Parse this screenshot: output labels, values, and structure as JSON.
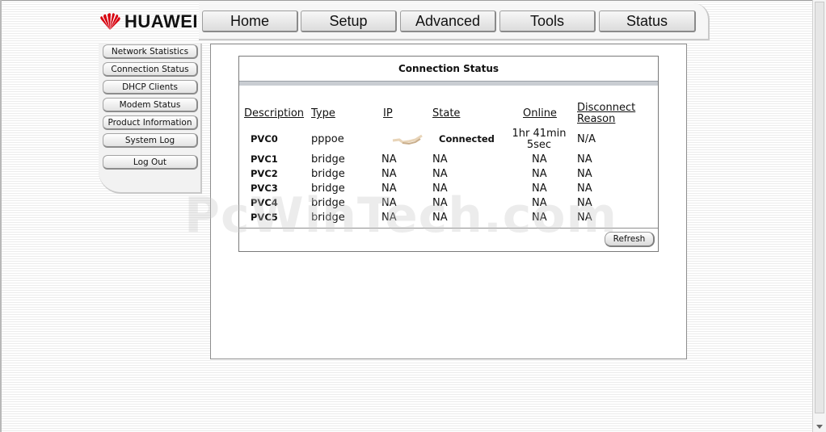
{
  "brand": {
    "name": "HUAWEI",
    "logo_color": "#d7000f"
  },
  "tabs": [
    {
      "label": "Home"
    },
    {
      "label": "Setup"
    },
    {
      "label": "Advanced"
    },
    {
      "label": "Tools"
    },
    {
      "label": "Status"
    }
  ],
  "sidebar": {
    "items": [
      {
        "label": "Network Statistics"
      },
      {
        "label": "Connection Status"
      },
      {
        "label": "DHCP Clients"
      },
      {
        "label": "Modem Status"
      },
      {
        "label": "Product Information"
      },
      {
        "label": "System Log"
      },
      {
        "label": "Log Out"
      }
    ]
  },
  "main": {
    "title": "Connection Status",
    "columns": {
      "description": "Description",
      "type": "Type",
      "ip": "IP",
      "state": "State",
      "online": "Online",
      "disconnect_line1": "Disconnect",
      "disconnect_line2": "Reason"
    },
    "rows": [
      {
        "description": "PVC0",
        "type": "pppoe",
        "ip": "",
        "state": "Connected",
        "online_line1": "1hr 41min",
        "online_line2": "5sec",
        "reason": "N/A"
      },
      {
        "description": "PVC1",
        "type": "bridge",
        "ip": "NA",
        "state": "NA",
        "online_line1": "NA",
        "online_line2": "",
        "reason": "NA"
      },
      {
        "description": "PVC2",
        "type": "bridge",
        "ip": "NA",
        "state": "NA",
        "online_line1": "NA",
        "online_line2": "",
        "reason": "NA"
      },
      {
        "description": "PVC3",
        "type": "bridge",
        "ip": "NA",
        "state": "NA",
        "online_line1": "NA",
        "online_line2": "",
        "reason": "NA"
      },
      {
        "description": "PVC4",
        "type": "bridge",
        "ip": "NA",
        "state": "NA",
        "online_line1": "NA",
        "online_line2": "",
        "reason": "NA"
      },
      {
        "description": "PVC5",
        "type": "bridge",
        "ip": "NA",
        "state": "NA",
        "online_line1": "NA",
        "online_line2": "",
        "reason": "NA"
      }
    ],
    "refresh_label": "Refresh"
  },
  "watermark": "PcWinTech.com"
}
